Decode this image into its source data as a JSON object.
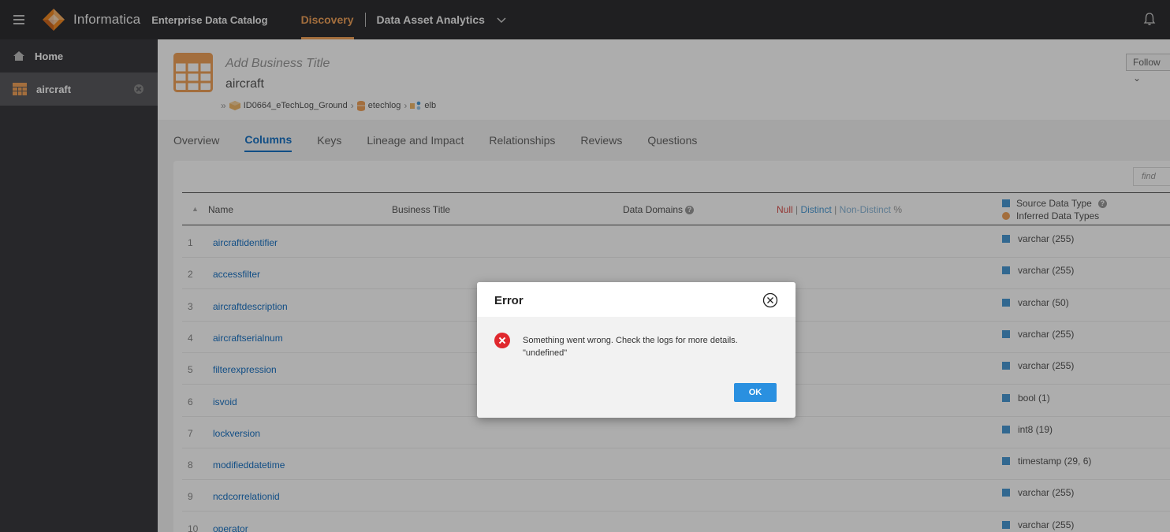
{
  "topbar": {
    "brand": "Informatica",
    "product": "Enterprise Data Catalog",
    "nav_discovery": "Discovery",
    "nav_analytics": "Data Asset Analytics",
    "icons": {
      "menu": "hamburger-icon",
      "logo": "informatica-logo-icon",
      "chevron": "chevron-down-icon",
      "notifications": "bell-icon"
    }
  },
  "sidebar": {
    "items": [
      {
        "label": "Home",
        "icon": "home-icon"
      },
      {
        "label": "aircraft",
        "icon": "table-icon",
        "active": true
      }
    ]
  },
  "asset": {
    "business_title": "Add Business Title",
    "name": "aircraft",
    "breadcrumb": [
      "ID0664_eTechLog_Ground",
      "etechlog",
      "elb"
    ],
    "follow_label": "Follow"
  },
  "tabs": [
    "Overview",
    "Columns",
    "Keys",
    "Lineage and Impact",
    "Relationships",
    "Reviews",
    "Questions"
  ],
  "active_tab": "Columns",
  "table": {
    "find_placeholder": "find",
    "headers": {
      "name": "Name",
      "business_title": "Business Title",
      "data_domains": "Data Domains",
      "stats_null": "Null",
      "stats_distinct": "Distinct",
      "stats_non_distinct": "Non-Distinct",
      "stats_percent": "%",
      "source_type": "Source Data Type",
      "inferred_type": "Inferred Data Types"
    },
    "rows": [
      {
        "num": "1",
        "name": "aircraftidentifier",
        "type": "varchar (255)"
      },
      {
        "num": "2",
        "name": "accessfilter",
        "type": "varchar (255)"
      },
      {
        "num": "3",
        "name": "aircraftdescription",
        "type": "varchar (50)"
      },
      {
        "num": "4",
        "name": "aircraftserialnum",
        "type": "varchar (255)"
      },
      {
        "num": "5",
        "name": "filterexpression",
        "type": "varchar (255)"
      },
      {
        "num": "6",
        "name": "isvoid",
        "type": "bool (1)"
      },
      {
        "num": "7",
        "name": "lockversion",
        "type": "int8 (19)"
      },
      {
        "num": "8",
        "name": "modifieddatetime",
        "type": "timestamp (29, 6)"
      },
      {
        "num": "9",
        "name": "ncdcorrelationid",
        "type": "varchar (255)"
      },
      {
        "num": "10",
        "name": "operator_",
        "type": "varchar (255)"
      }
    ]
  },
  "dialog": {
    "title": "Error",
    "message": "Something went wrong. Check the logs for more details.",
    "detail": "\"undefined\"",
    "ok_label": "OK"
  },
  "colors": {
    "accent_orange": "#f0a35a",
    "link_blue": "#1a73c5",
    "error_red": "#e0282e",
    "ok_button": "#2a90e0",
    "topbar": "#2f2f32"
  }
}
